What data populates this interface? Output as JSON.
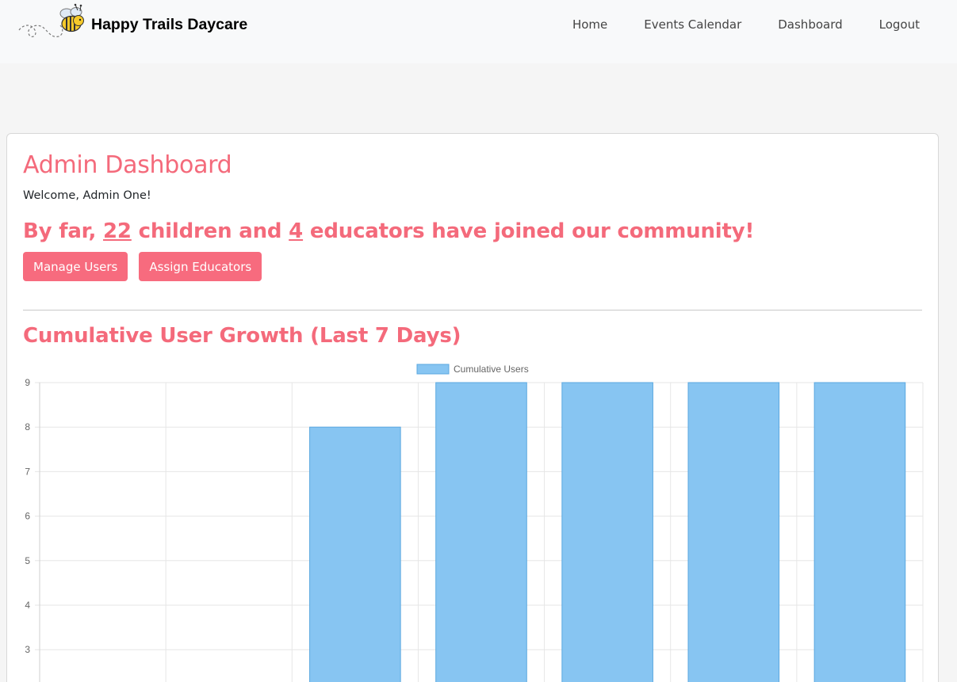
{
  "nav": {
    "brand": "Happy Trails Daycare",
    "links": [
      "Home",
      "Events Calendar",
      "Dashboard",
      "Logout"
    ]
  },
  "dashboard": {
    "title": "Admin Dashboard",
    "welcome": "Welcome, Admin One!",
    "community_prefix": "By far, ",
    "children_count": "22",
    "community_mid": " children and ",
    "educators_count": "4",
    "community_suffix": " educators have joined our community!",
    "buttons": [
      "Manage Users",
      "Assign Educators"
    ]
  },
  "chart_title": "Cumulative User Growth (Last 7 Days)",
  "colors": {
    "accent": "#f46a7b",
    "button": "#f76b7e",
    "bar_fill": "#87c5f2",
    "bar_border": "#5ba8e0"
  },
  "chart_data": {
    "type": "bar",
    "title": "",
    "xlabel": "",
    "ylabel": "",
    "categories": [
      "",
      "",
      "",
      "",
      "",
      "",
      ""
    ],
    "series": [
      {
        "name": "Cumulative Users",
        "values": [
          null,
          null,
          8,
          9,
          9,
          9,
          9
        ]
      }
    ],
    "y_ticks": [
      9,
      8,
      7,
      6,
      5,
      4,
      3
    ],
    "y_range_visible": [
      2.3,
      9
    ],
    "grid": true,
    "legend": "top-center"
  }
}
